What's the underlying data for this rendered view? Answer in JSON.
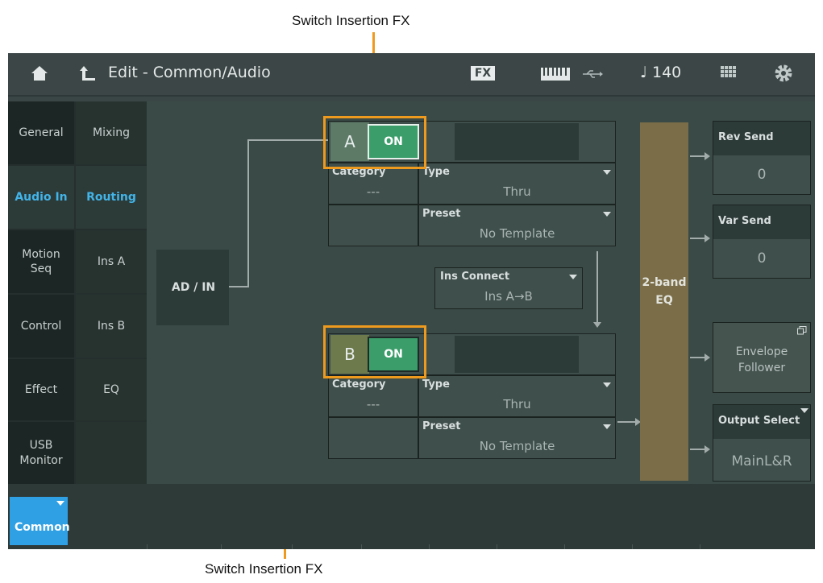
{
  "callouts": {
    "top": "Switch Insertion FX",
    "bottom": "Switch Insertion FX"
  },
  "header": {
    "title": "Edit - Common/Audio",
    "fx_badge": "FX",
    "tempo": "♩ 140",
    "icons": [
      "home-icon",
      "back-arrow-icon",
      "keyboard-icon",
      "usb-icon",
      "grid-icon",
      "gear-icon"
    ]
  },
  "nav": {
    "col1": [
      {
        "label": "General"
      },
      {
        "label": "Audio In",
        "selected": true
      },
      {
        "label": "Motion\nSeq"
      },
      {
        "label": "Control"
      },
      {
        "label": "Effect"
      },
      {
        "label": "USB\nMonitor"
      }
    ],
    "col2": [
      {
        "label": "Mixing"
      },
      {
        "label": "Routing",
        "selected": true
      },
      {
        "label": "Ins A"
      },
      {
        "label": "Ins B"
      },
      {
        "label": "EQ"
      }
    ]
  },
  "main": {
    "input": "AD / IN",
    "ins_a": {
      "letter": "A",
      "switch": "ON",
      "category_label": "Category",
      "category_value": "---",
      "type_label": "Type",
      "type_value": "Thru",
      "preset_label": "Preset",
      "preset_value": "No Template"
    },
    "ins_b": {
      "letter": "B",
      "switch": "ON",
      "category_label": "Category",
      "category_value": "---",
      "type_label": "Type",
      "type_value": "Thru",
      "preset_label": "Preset",
      "preset_value": "No Template"
    },
    "ins_connect": {
      "label": "Ins Connect",
      "value": "Ins A→B"
    },
    "eq": "2-band\nEQ",
    "rev_send": {
      "label": "Rev Send",
      "value": "0"
    },
    "var_send": {
      "label": "Var Send",
      "value": "0"
    },
    "envelope": "Envelope\nFollower",
    "output_select": {
      "label": "Output Select",
      "value": "MainL&R"
    }
  },
  "footer": {
    "common": "Common"
  },
  "colors": {
    "accent_blue": "#2fa0e4",
    "on_green": "#3a9d6a",
    "callout_orange": "#ee9a1e",
    "eq_brown": "#7a6d48"
  }
}
